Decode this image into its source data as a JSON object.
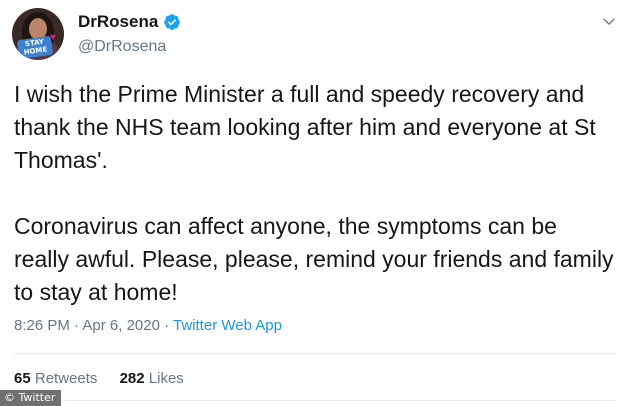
{
  "author": {
    "display_name": "DrRosena",
    "handle": "@DrRosena",
    "verified": true,
    "avatar_badge_text": "STAY HOME",
    "avatar_icon": "profile-photo"
  },
  "icons": {
    "verified": "verified-badge-icon",
    "menu": "chevron-down-icon",
    "avatar_heart": "heart-icon"
  },
  "tweet": {
    "paragraphs": [
      "I wish the Prime Minister a full and speedy recovery and thank the NHS team looking after him and everyone at St Thomas'.",
      "Coronavirus can affect anyone, the symptoms can be really awful. Please, please, remind your friends and family to stay at home!"
    ]
  },
  "meta": {
    "time": "8:26 PM",
    "separator": " · ",
    "date": "Apr 6, 2020",
    "app": "Twitter Web App"
  },
  "stats": {
    "retweets_count": "65",
    "retweets_label": "Retweets",
    "likes_count": "282",
    "likes_label": "Likes"
  },
  "credit": "© Twitter",
  "colors": {
    "text": "#14171a",
    "secondary": "#657786",
    "link": "#1b95e0",
    "verified": "#1da1f2",
    "divider": "#e6ecf0"
  }
}
